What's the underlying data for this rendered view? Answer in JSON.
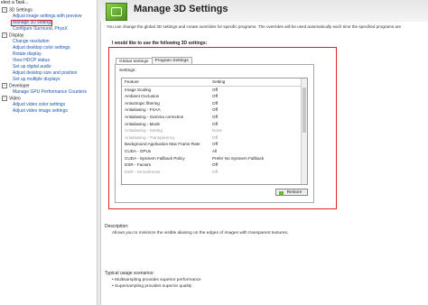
{
  "sidebar": {
    "title": "elect a Task...",
    "categories": [
      {
        "label": "3D Settings",
        "toggle": "−",
        "items": [
          "Adjust image settings with preview",
          "Manage 3D settings",
          "Configure Surround, PhysX"
        ]
      },
      {
        "label": "Display",
        "toggle": "−",
        "items": [
          "Change resolution",
          "Adjust desktop color settings",
          "Rotate display",
          "View HDCP status",
          "Set up digital audio",
          "Adjust desktop size and position",
          "Set up multiple displays"
        ]
      },
      {
        "label": "Developer",
        "toggle": "−",
        "items": [
          "Manage GPU Performance Counters"
        ]
      },
      {
        "label": "Video",
        "toggle": "−",
        "items": [
          "Adjust video color settings",
          "Adjust video image settings"
        ]
      }
    ]
  },
  "header": {
    "title": "Manage 3D Settings"
  },
  "intro": "You can change the global 3D settings and create overrides for specific programs. The overrides will be used automatically each time the specified programs are",
  "section_title": "I would like to use the following 3D settings:",
  "tabs": [
    "Global Settings",
    "Program Settings"
  ],
  "settings_label": "Settings:",
  "grid": {
    "headers": [
      "Feature",
      "Setting"
    ],
    "rows": [
      {
        "feature": "Image Scaling",
        "setting": "Off",
        "dim": false
      },
      {
        "feature": "Ambient Occlusion",
        "setting": "Off",
        "dim": false
      },
      {
        "feature": "Anisotropic filtering",
        "setting": "Off",
        "dim": false
      },
      {
        "feature": "Antialiasing - FXAA",
        "setting": "Off",
        "dim": false
      },
      {
        "feature": "Antialiasing - Gamma correction",
        "setting": "Off",
        "dim": false
      },
      {
        "feature": "Antialiasing - Mode",
        "setting": "Off",
        "dim": false
      },
      {
        "feature": "Antialiasing - Setting",
        "setting": "None",
        "dim": true
      },
      {
        "feature": "Antialiasing - Transparency",
        "setting": "Off",
        "dim": true
      },
      {
        "feature": "Background Application Max Frame Rate",
        "setting": "Off",
        "dim": false
      },
      {
        "feature": "CUDA - GPUs",
        "setting": "All",
        "dim": false
      },
      {
        "feature": "CUDA - Sysmem Fallback Policy",
        "setting": "Prefer No Sysmem Fallback",
        "dim": false
      },
      {
        "feature": "DSR - Factors",
        "setting": "Off",
        "dim": false
      },
      {
        "feature": "DSR - Smoothness",
        "setting": "Off",
        "dim": true
      }
    ]
  },
  "restore_label": "Restore",
  "description": {
    "label": "Description:",
    "text": "Allows you to minimize the visible aliasing on the edges of images with transparent textures."
  },
  "usage": {
    "label": "Typical usage scenarios:",
    "items": [
      "• Multisampling provides superior performance",
      "• Supersampling provides superior quality"
    ]
  },
  "colors": {
    "highlight": "#d22222",
    "link": "#1a56b0",
    "nvidia_green": "#76b900"
  }
}
